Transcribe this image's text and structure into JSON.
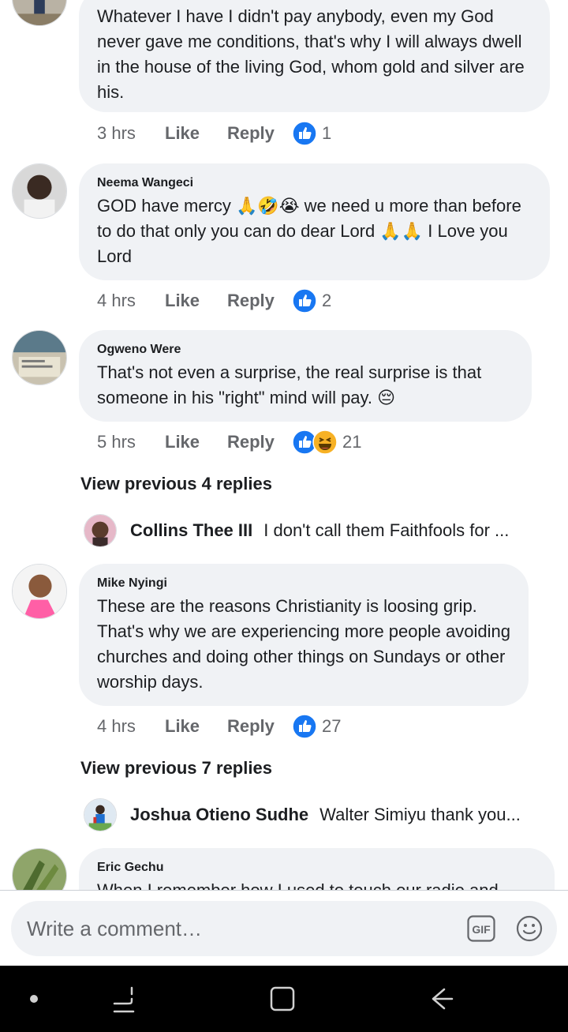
{
  "comments": [
    {
      "author": "",
      "text": "Whatever I have I didn't pay anybody, even my God never gave me conditions, that's why I will always dwell in the house of the living God, whom gold and silver are his.",
      "time": "3 hrs",
      "reaction_count": "1",
      "reactions": [
        "like-icon"
      ]
    },
    {
      "author": "Neema Wangeci",
      "text": "GOD have mercy 🙏🤣😭 we need u more than before to do that  only you can do dear Lord 🙏🙏 I Love you Lord",
      "time": "4 hrs",
      "reaction_count": "2",
      "reactions": [
        "like-icon"
      ]
    },
    {
      "author": "Ogweno Were",
      "text": "That's not even a surprise, the real surprise is that someone in his \"right\" mind will pay. 😔",
      "time": "5 hrs",
      "reaction_count": "21",
      "reactions": [
        "like-icon",
        "haha-icon"
      ],
      "view_previous": "View previous 4 replies",
      "reply_preview": {
        "name": "Collins Thee III",
        "text": "I don't call them Faithfools for ..."
      }
    },
    {
      "author": "Mike Nyingi",
      "text": "These are the reasons Christianity is loosing grip. That's why we are experiencing more people avoiding churches and doing other things on Sundays or other worship days.",
      "time": "4 hrs",
      "reaction_count": "27",
      "reactions": [
        "like-icon"
      ],
      "view_previous": "View previous 7 replies",
      "reply_preview": {
        "name": "Joshua Otieno Sudhe",
        "text": "Walter Simiyu thank you..."
      }
    },
    {
      "author": "Eric Gechu",
      "text": "When I remember how I used to touch our radio and"
    }
  ],
  "action_labels": {
    "like": "Like",
    "reply": "Reply"
  },
  "composer": {
    "placeholder": "Write a comment…",
    "gif_label": "GIF"
  },
  "colors": {
    "like_blue": "#1877f2",
    "bubble_bg": "#f0f2f5",
    "meta_gray": "#65676b"
  }
}
